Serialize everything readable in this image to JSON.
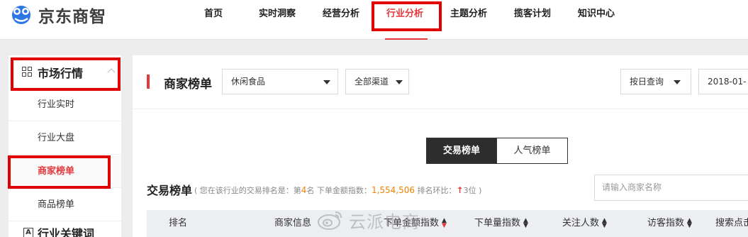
{
  "brand": {
    "logo_text": "京东商智"
  },
  "nav": {
    "items": [
      {
        "label": "首页"
      },
      {
        "label": "实时洞察"
      },
      {
        "label": "经营分析"
      },
      {
        "label": "行业分析",
        "active": true
      },
      {
        "label": "主题分析"
      },
      {
        "label": "揽客计划"
      },
      {
        "label": "知识中心"
      }
    ]
  },
  "sidebar": {
    "section_label": "市场行情",
    "items": [
      {
        "label": "行业实时"
      },
      {
        "label": "行业大盘"
      },
      {
        "label": "商家榜单",
        "active": true
      },
      {
        "label": "商品榜单"
      }
    ],
    "next_section_label": "行业关键词"
  },
  "main": {
    "title": "商家榜单",
    "filters": {
      "category": "休闲食品",
      "channel": "全部渠道",
      "query_mode": "按日查询",
      "date": "2018-01-"
    },
    "tabs": [
      {
        "label": "交易榜单",
        "active": true
      },
      {
        "label": "人气榜单"
      }
    ],
    "section": {
      "title": "交易榜单",
      "sub_prefix": "( 您在该行业的交易排名是：第",
      "rank": "4",
      "sub_mid1": "名  下单金额指数：",
      "amount_index": "1,554,506",
      "sub_mid2": "  排名环比：",
      "change_arrow": "↑",
      "change_value": "3位",
      "sub_suffix": " )"
    },
    "search_placeholder": "请输入商家名称",
    "table": {
      "columns": [
        "排名",
        "商家信息",
        "下单金额指数",
        "下单量指数",
        "关注人数",
        "访客指数",
        "搜索点击"
      ]
    }
  },
  "watermark": {
    "text": "云派电商"
  },
  "colors": {
    "accent": "#e4393c",
    "highlight": "#e10000",
    "orange": "#f08300"
  }
}
